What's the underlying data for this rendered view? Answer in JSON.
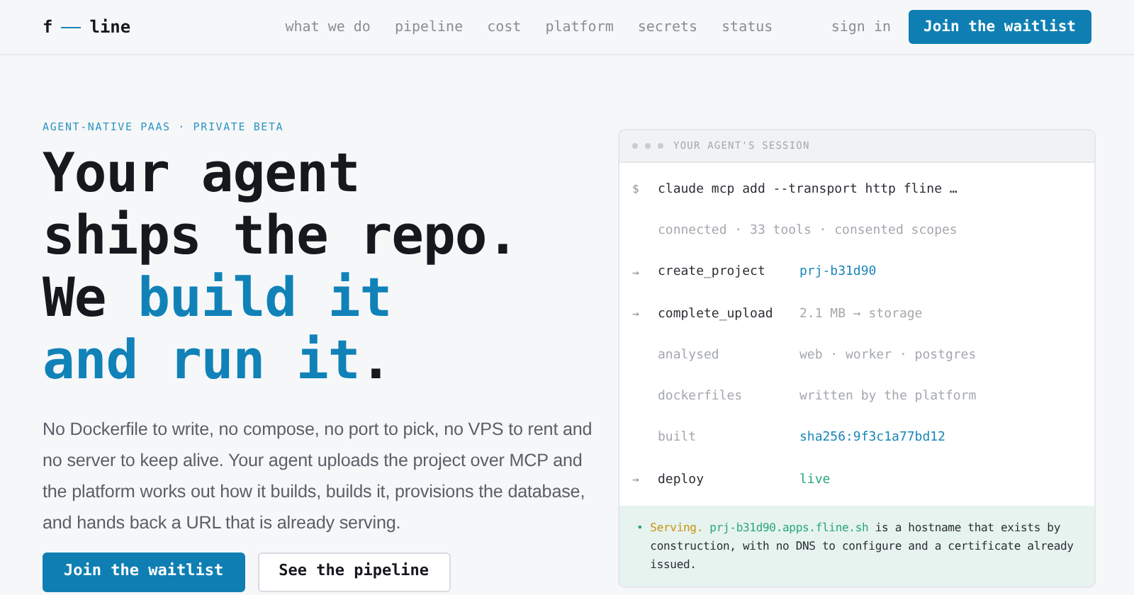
{
  "nav": {
    "logo": {
      "left": "f",
      "right": "line"
    },
    "links": [
      "what we do",
      "pipeline",
      "cost",
      "platform",
      "secrets",
      "status"
    ],
    "sign_in": "sign in",
    "cta": "Join the waitlist"
  },
  "hero": {
    "eyebrow": "AGENT-NATIVE PAAS · PRIVATE BETA",
    "headline": [
      [
        {
          "text": "Your agent",
          "accent": false
        }
      ],
      [
        {
          "text": "ships the repo.",
          "accent": false
        }
      ],
      [
        {
          "text": "We ",
          "accent": false
        },
        {
          "text": "build it",
          "accent": true
        }
      ],
      [
        {
          "text": "and run it",
          "accent": true
        },
        {
          "text": ".",
          "accent": false
        }
      ]
    ],
    "body": "No Dockerfile to write, no compose, no port to pick, no VPS to rent and no server to keep alive. Your agent uploads the project over MCP and the platform works out how it builds, builds it, provisions the database, and hands back a URL that is already serving.",
    "buttons": [
      {
        "label": "Join the waitlist",
        "kind": "primary"
      },
      {
        "label": "See the pipeline",
        "kind": "secondary"
      }
    ]
  },
  "session": {
    "title": "YOUR AGENT'S SESSION",
    "rows": [
      {
        "kind": "command",
        "marker": "$",
        "text": "claude mcp add --transport http fline …"
      },
      {
        "kind": "note",
        "text": "connected · 33 tools · consented scopes"
      },
      {
        "kind": "step",
        "marker": "→",
        "label": "create_project",
        "value": "prj-b31d90",
        "color": "#1a86b8"
      },
      {
        "kind": "step",
        "marker": "→",
        "label": "complete_upload",
        "value": "2.1 MB → storage",
        "color": "#a4a8ad"
      },
      {
        "kind": "detail",
        "label": "analysed",
        "value": "web · worker · postgres",
        "color": "#a4a8ad"
      },
      {
        "kind": "detail",
        "label": "dockerfiles",
        "value": "written by the platform",
        "color": "#a4a8ad"
      },
      {
        "kind": "detail",
        "label": "built",
        "value": "sha256:9f3c1a77bd12",
        "color": "#1a86b8"
      },
      {
        "kind": "step",
        "marker": "→",
        "label": "deploy",
        "value": "live",
        "color": "#2aa57a"
      }
    ],
    "result": {
      "marker": "•",
      "parts": [
        {
          "text": "Serving. ",
          "color": "#c9930e"
        },
        {
          "text": "prj-b31d90.apps.fline.sh",
          "color": "#2aa57a"
        },
        {
          "text": " is a hostname that exists by construction, with no DNS to configure and a certificate already issued.",
          "color": "#2a2d33"
        }
      ]
    }
  }
}
